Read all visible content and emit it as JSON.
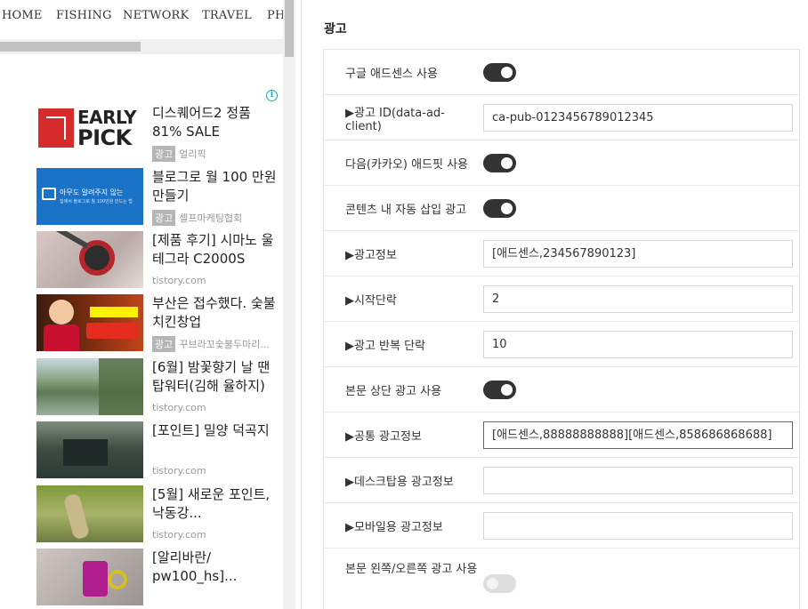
{
  "nav": {
    "items": [
      "HOME",
      "FISHING",
      "NETWORK",
      "TRAVEL",
      "PH"
    ]
  },
  "ads": [
    {
      "title": "디스퀘어드2 정품 81% SALE",
      "badge": "광고",
      "source": "얼리픽",
      "thumb": "early-pick-logo",
      "logo_text_1": "EARLY",
      "logo_text_2": "PICK"
    },
    {
      "title": "블로그로 월 100 만원 만들기",
      "badge": "광고",
      "source": "셀프마케팅협회",
      "thumb": "blog-banner",
      "banner_line_1": "아무도 알려주지 않는",
      "banner_line_2": "집에서 블로그로 월 100만원 만드는 법"
    },
    {
      "title": "[제품 후기] 시마노 울테그라 C2000S",
      "badge": "",
      "source": "tistory.com",
      "thumb": "fishing-reel-photo"
    },
    {
      "title": "부산은 접수했다. 숯불치킨창업",
      "badge": "광고",
      "source": "꾸브라꼬숯불두마리...",
      "thumb": "chicken-franchise-banner"
    },
    {
      "title": "[6월] 밤꽃향기 날 땐 탑워터(김해 율하지)",
      "badge": "",
      "source": "tistory.com",
      "thumb": "lake-photo"
    },
    {
      "title": "[포인트] 밀양 덕곡지",
      "badge": "",
      "source": "tistory.com",
      "thumb": "pond-photo"
    },
    {
      "title": "[5월] 새로운 포인트, 낙동강...",
      "badge": "",
      "source": "tistory.com",
      "thumb": "bass-catch-photo"
    },
    {
      "title": "[알리바란/ pw100_hs]...",
      "badge": "",
      "source": "",
      "thumb": "reel-parts-photo"
    }
  ],
  "settings": {
    "section_title": "광고",
    "rows": [
      {
        "label": "구글 애드센스 사용",
        "type": "toggle",
        "on": true
      },
      {
        "label": "▶광고 ID(data-ad-client)",
        "type": "text",
        "value": "ca-pub-0123456789012345"
      },
      {
        "label": "다음(카카오) 애드핏 사용",
        "type": "toggle",
        "on": true
      },
      {
        "label": "콘텐츠 내 자동 삽입 광고",
        "type": "toggle",
        "on": true
      },
      {
        "label": "▶광고정보",
        "type": "text",
        "value": "[애드센스,234567890123]"
      },
      {
        "label": "▶시작단락",
        "type": "text",
        "value": "2"
      },
      {
        "label": "▶광고 반복 단락",
        "type": "text",
        "value": "10"
      },
      {
        "label": "본문 상단 광고 사용",
        "type": "toggle",
        "on": true
      },
      {
        "label": "▶공통 광고정보",
        "type": "text",
        "value": "[애드센스,88888888888][애드센스,858686868688]",
        "focused": true
      },
      {
        "label": "▶데스크탑용 광고정보",
        "type": "text",
        "value": ""
      },
      {
        "label": "▶모바일용 광고정보",
        "type": "text",
        "value": ""
      },
      {
        "label": "본문 왼쪽/오른쪽 광고 사용",
        "type": "toggle",
        "on": false
      }
    ]
  },
  "colors": {
    "toggle_on": "#333333",
    "toggle_off": "#dddddd",
    "badge": "#b5b5b5",
    "info_icon": "#00aecd"
  }
}
